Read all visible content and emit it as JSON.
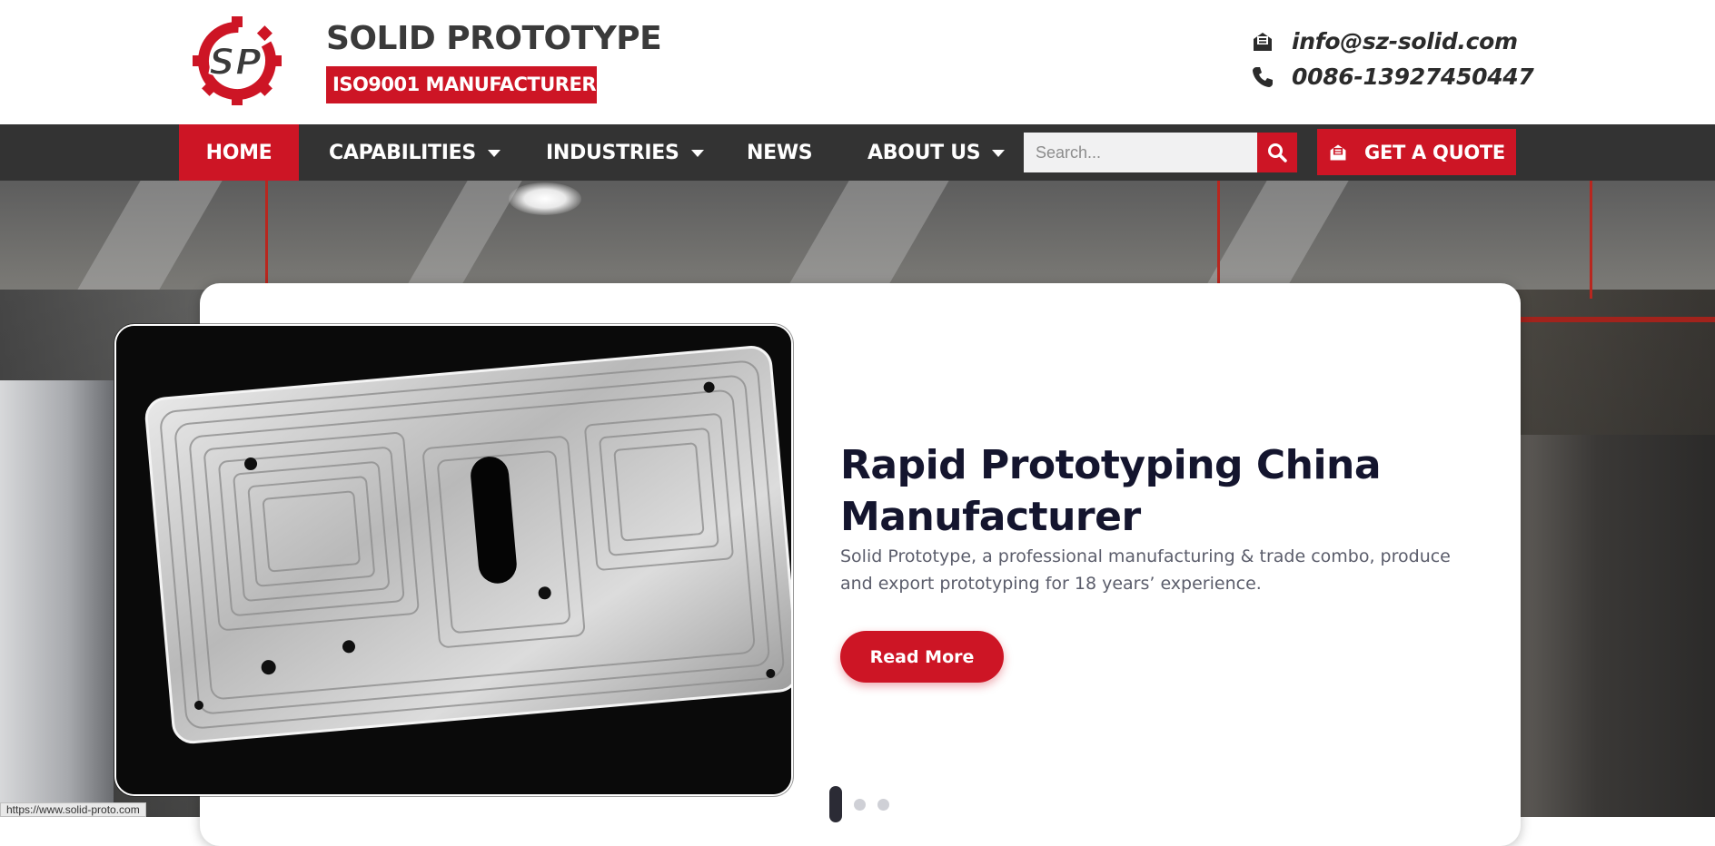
{
  "header": {
    "logo_text": "SP",
    "brand_title": "SOLID PROTOTYPE",
    "brand_badge": "ISO9001 MANUFACTURER",
    "email": "info@sz-solid.com",
    "phone": "0086-13927450447"
  },
  "nav": {
    "items": [
      {
        "label": "HOME"
      },
      {
        "label": "CAPABILITIES"
      },
      {
        "label": "INDUSTRIES"
      },
      {
        "label": "NEWS"
      },
      {
        "label": "ABOUT US"
      }
    ],
    "search_placeholder": "Search...",
    "quote_label": "GET A QUOTE"
  },
  "hero": {
    "title": "Rapid Prototyping China Manufacturer",
    "description": "Solid Prototype, a professional manufacturing & trade combo, produce and export prototyping for 18 years’ experience.",
    "button_label": "Read More",
    "active_slide": 1,
    "slide_count": 3
  },
  "status_bar": {
    "url": "https://www.solid-proto.com"
  },
  "colors": {
    "brand_red": "#cd1525",
    "nav_bg": "#333333",
    "title_dark": "#14152e",
    "text_gray": "#5b5d6b"
  },
  "icons": {
    "email": "envelope-open-icon",
    "phone": "phone-icon",
    "search": "search-icon",
    "quote": "envelope-open-icon",
    "dropdown": "caret-down-icon"
  }
}
